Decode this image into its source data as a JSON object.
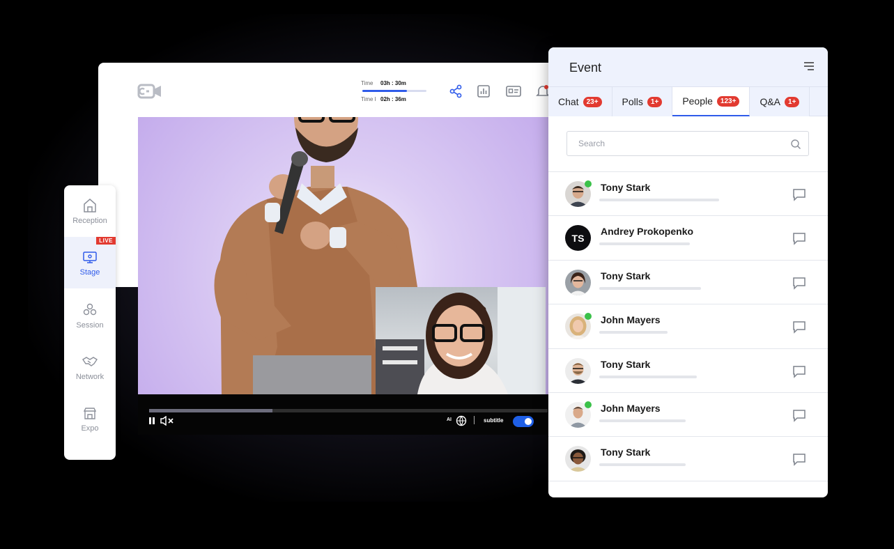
{
  "stage": {
    "timer": {
      "time_label": "Time",
      "time_value": "03h : 30m",
      "left_label": "Time left",
      "left_value": "02h : 36m",
      "progress": 0.7
    },
    "top_icons": [
      "share-icon",
      "bar-chart-icon",
      "id-card-icon",
      "bell-icon"
    ],
    "player": {
      "seek_progress": 0.31,
      "ai_label": "AI",
      "subtitle_label": "subtitle",
      "subtitle_on": true
    }
  },
  "leftnav": {
    "items": [
      {
        "label": "Reception",
        "icon": "home-icon"
      },
      {
        "label": "Stage",
        "icon": "stage-icon",
        "badge": "LIVE"
      },
      {
        "label": "Session",
        "icon": "session-icon"
      },
      {
        "label": "Network",
        "icon": "handshake-icon"
      },
      {
        "label": "Expo",
        "icon": "booth-icon"
      }
    ]
  },
  "panel": {
    "title": "Event",
    "tabs": [
      {
        "label": "Chat",
        "badge": "23+"
      },
      {
        "label": "Polls",
        "badge": "1+"
      },
      {
        "label": "People",
        "badge": "123+"
      },
      {
        "label": "Q&A",
        "badge": "1+"
      }
    ],
    "active_tab": "People",
    "search_placeholder": "Search",
    "people": [
      {
        "name": "Tony Stark",
        "online": true
      },
      {
        "name": "Andrey Prokopenko",
        "initials": "TS",
        "online": false
      },
      {
        "name": "Tony Stark",
        "online": false
      },
      {
        "name": "John Mayers",
        "online": true
      },
      {
        "name": "Tony Stark",
        "online": false
      },
      {
        "name": "John Mayers",
        "online": true
      },
      {
        "name": "Tony Stark",
        "online": false
      }
    ]
  },
  "colors": {
    "accent": "#2f5bea",
    "badge": "#e23a30",
    "online": "#3bc14a"
  }
}
